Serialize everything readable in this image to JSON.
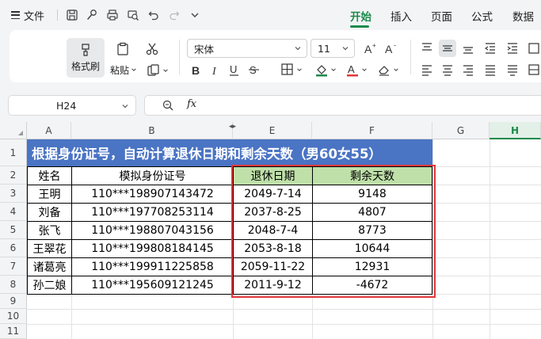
{
  "menu": {
    "file_label": "文件",
    "tabs": [
      {
        "label": "开始",
        "active": true
      },
      {
        "label": "插入",
        "active": false
      },
      {
        "label": "页面",
        "active": false
      },
      {
        "label": "公式",
        "active": false
      },
      {
        "label": "数据",
        "active": false
      }
    ],
    "quick_access_icons": [
      "save-icon",
      "brush-icon",
      "print-icon",
      "print-preview-icon",
      "undo-icon",
      "redo-icon",
      "more-icon"
    ]
  },
  "ribbon": {
    "format_painter_label": "格式刷",
    "paste_label": "粘贴",
    "font_name": "宋体",
    "font_size": "11",
    "font_color": "#e0383b",
    "fill_color": "#1d8a4b"
  },
  "formula_bar": {
    "cell_ref": "H24",
    "fx_label": "fx",
    "formula": ""
  },
  "sheet": {
    "columns": [
      "A",
      "B",
      "",
      "E",
      "F",
      "G",
      "H"
    ],
    "selected_column": "H",
    "rows": [
      "1",
      "2",
      "3",
      "4",
      "5",
      "6",
      "7",
      "8",
      "9",
      "10",
      "11"
    ],
    "title": "根据身份证号，自动计算退休日期和剩余天数（男60女55）",
    "headers": {
      "name": "姓名",
      "id": "模拟身份证号",
      "retire": "退休日期",
      "days": "剩余天数"
    },
    "records": [
      {
        "name": "王明",
        "id": "110***198907143472",
        "retire": "2049-7-14",
        "days": "9148"
      },
      {
        "name": "刘备",
        "id": "110***197708253114",
        "retire": "2037-8-25",
        "days": "4807"
      },
      {
        "name": "张飞",
        "id": "110***198807043156",
        "retire": "2048-7-4",
        "days": "8773"
      },
      {
        "name": "王翠花",
        "id": "110***199808184145",
        "retire": "2053-8-18",
        "days": "10644"
      },
      {
        "name": "诸葛亮",
        "id": "110***199911225858",
        "retire": "2059-11-22",
        "days": "12931"
      },
      {
        "name": "孙二娘",
        "id": "110***195609121245",
        "retire": "2011-9-12",
        "days": "-4672"
      }
    ],
    "header_fill": "#bfe0a9",
    "title_fill": "#4a74c4",
    "highlight_border": "#e0383b"
  }
}
